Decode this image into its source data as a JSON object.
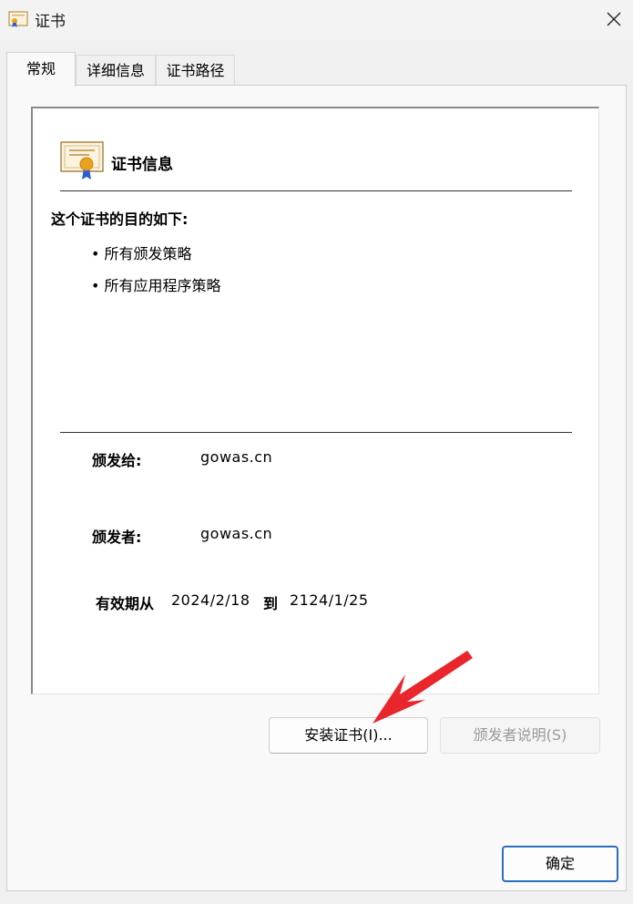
{
  "window": {
    "title": "证书"
  },
  "tabs": [
    {
      "label": "常规",
      "active": true
    },
    {
      "label": "详细信息",
      "active": false
    },
    {
      "label": "证书路径",
      "active": false
    }
  ],
  "info": {
    "title": "证书信息",
    "purpose_heading": "这个证书的目的如下:",
    "purposes": [
      "• 所有颁发策略",
      "• 所有应用程序策略"
    ],
    "issued_to_label": "颁发给:",
    "issued_to_value": "gowas.cn",
    "issued_by_label": "颁发者:",
    "issued_by_value": "gowas.cn",
    "valid_from_label": "有效期从",
    "valid_from": "2024/2/18",
    "valid_to_label": "到",
    "valid_to": "2124/1/25"
  },
  "buttons": {
    "install": "安装证书(I)...",
    "issuer_statement": "颁发者说明(S)",
    "ok": "确定"
  },
  "colors": {
    "accent": "#2a6fb8",
    "arrow": "#e8262b"
  },
  "icons": {
    "window": "certificate-icon",
    "close": "close-icon",
    "info": "certificate-icon",
    "annotation": "red-arrow-icon"
  }
}
